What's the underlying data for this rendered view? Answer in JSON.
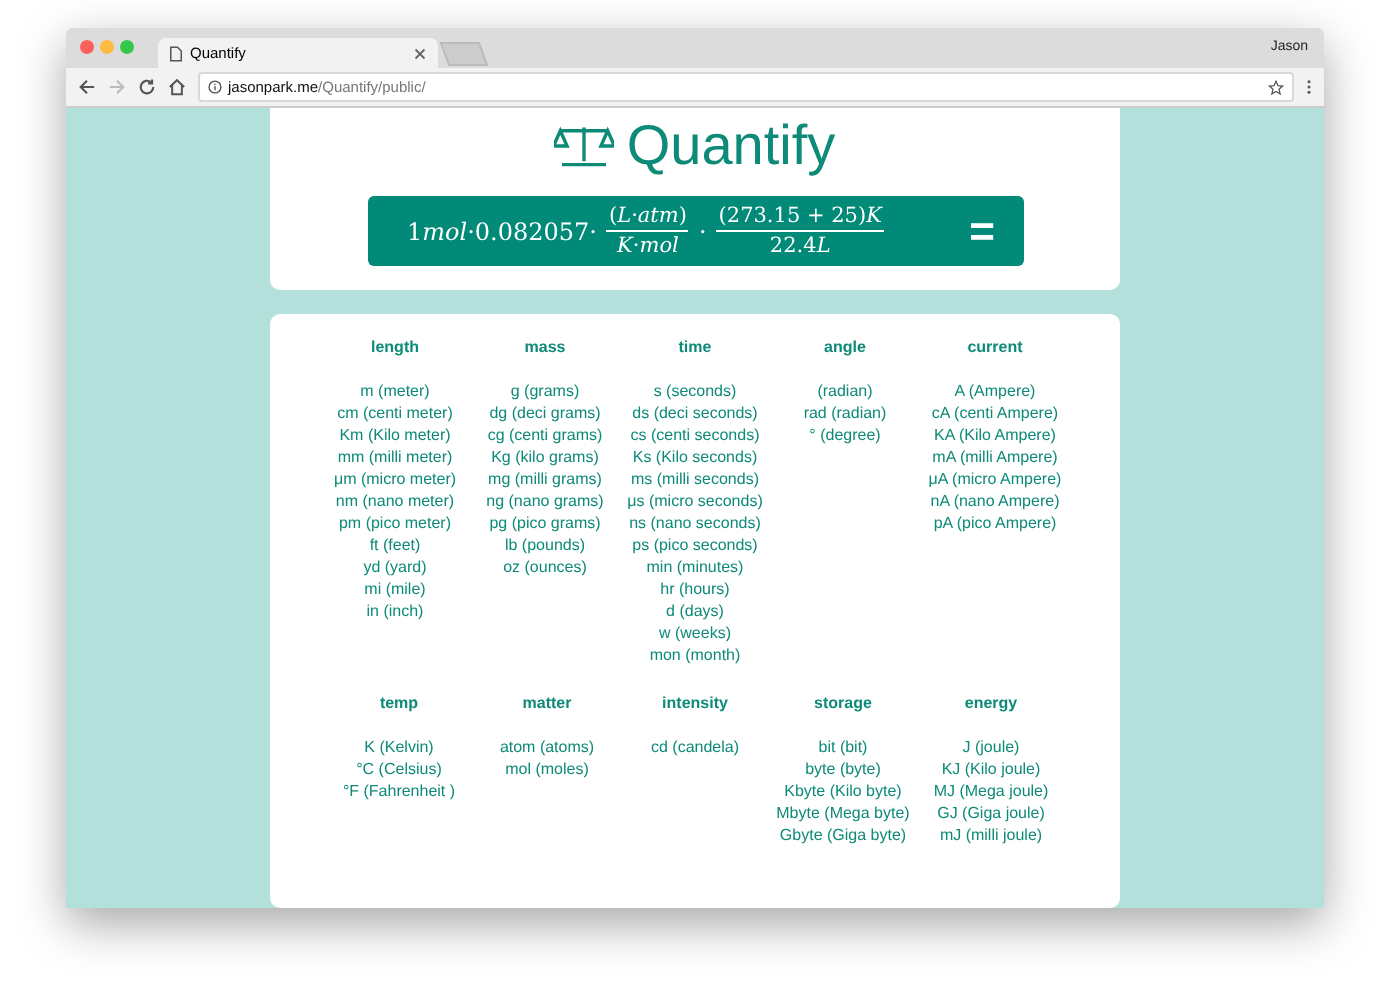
{
  "browser": {
    "tab_title": "Quantify",
    "profile": "Jason",
    "url_host": "jasonpark.me",
    "url_path": "/Quantify/public/"
  },
  "app_title": "Quantify",
  "formula": {
    "lead": [
      {
        "kind": "num",
        "text": "1"
      },
      {
        "kind": "var",
        "text": "mol"
      },
      {
        "kind": "num",
        "text": "·0.082057·"
      }
    ],
    "fractions": [
      {
        "numerator": [
          {
            "kind": "num",
            "text": "("
          },
          {
            "kind": "var",
            "text": "L"
          },
          {
            "kind": "num",
            "text": "·"
          },
          {
            "kind": "var",
            "text": "atm"
          },
          {
            "kind": "num",
            "text": ")"
          }
        ],
        "denominator": [
          {
            "kind": "var",
            "text": "K"
          },
          {
            "kind": "num",
            "text": "·"
          },
          {
            "kind": "var",
            "text": "mol"
          }
        ]
      },
      {
        "numerator": [
          {
            "kind": "num",
            "text": "(273.15 + 25)"
          },
          {
            "kind": "var",
            "text": "K"
          }
        ],
        "denominator": [
          {
            "kind": "num",
            "text": "22.4"
          },
          {
            "kind": "var",
            "text": "L"
          }
        ]
      }
    ],
    "separator": "·",
    "equals": "="
  },
  "unit_rows": [
    [
      {
        "title": "length",
        "units": [
          "m (meter)",
          "cm (centi meter)",
          "Km (Kilo meter)",
          "mm (milli meter)",
          "μm (micro meter)",
          "nm (nano meter)",
          "pm (pico meter)",
          "ft (feet)",
          "yd (yard)",
          "mi (mile)",
          "in (inch)"
        ]
      },
      {
        "title": "mass",
        "units": [
          "g (grams)",
          "dg (deci grams)",
          "cg (centi grams)",
          "Kg (kilo grams)",
          "mg (milli grams)",
          "ng (nano grams)",
          "pg (pico grams)",
          "lb (pounds)",
          "oz (ounces)"
        ]
      },
      {
        "title": "time",
        "units": [
          "s (seconds)",
          "ds (deci seconds)",
          "cs (centi seconds)",
          "Ks (Kilo seconds)",
          "ms (milli seconds)",
          "μs (micro seconds)",
          "ns (nano seconds)",
          "ps (pico seconds)",
          "min (minutes)",
          "hr (hours)",
          "d (days)",
          "w (weeks)",
          "mon (month)"
        ]
      },
      {
        "title": "angle",
        "units": [
          "(radian)",
          "rad (radian)",
          "° (degree)"
        ]
      },
      {
        "title": "current",
        "units": [
          "A (Ampere)",
          "cA (centi Ampere)",
          "KA (Kilo Ampere)",
          "mA (milli Ampere)",
          "μA (micro Ampere)",
          "nA (nano Ampere)",
          "pA (pico Ampere)"
        ]
      }
    ],
    [
      {
        "title": "temp",
        "units": [
          "K (Kelvin)",
          "°C (Celsius)",
          "°F (Fahrenheit )"
        ]
      },
      {
        "title": "matter",
        "units": [
          "atom (atoms)",
          "mol (moles)"
        ]
      },
      {
        "title": "intensity",
        "units": [
          "cd (candela)"
        ]
      },
      {
        "title": "storage",
        "units": [
          "bit (bit)",
          "byte (byte)",
          "Kbyte (Kilo byte)",
          "Mbyte (Mega byte)",
          "Gbyte (Giga byte)"
        ]
      },
      {
        "title": "energy",
        "units": [
          "J (joule)",
          "KJ (Kilo joule)",
          "MJ (Mega joule)",
          "GJ (Giga joule)",
          "mJ (milli joule)"
        ]
      }
    ]
  ]
}
